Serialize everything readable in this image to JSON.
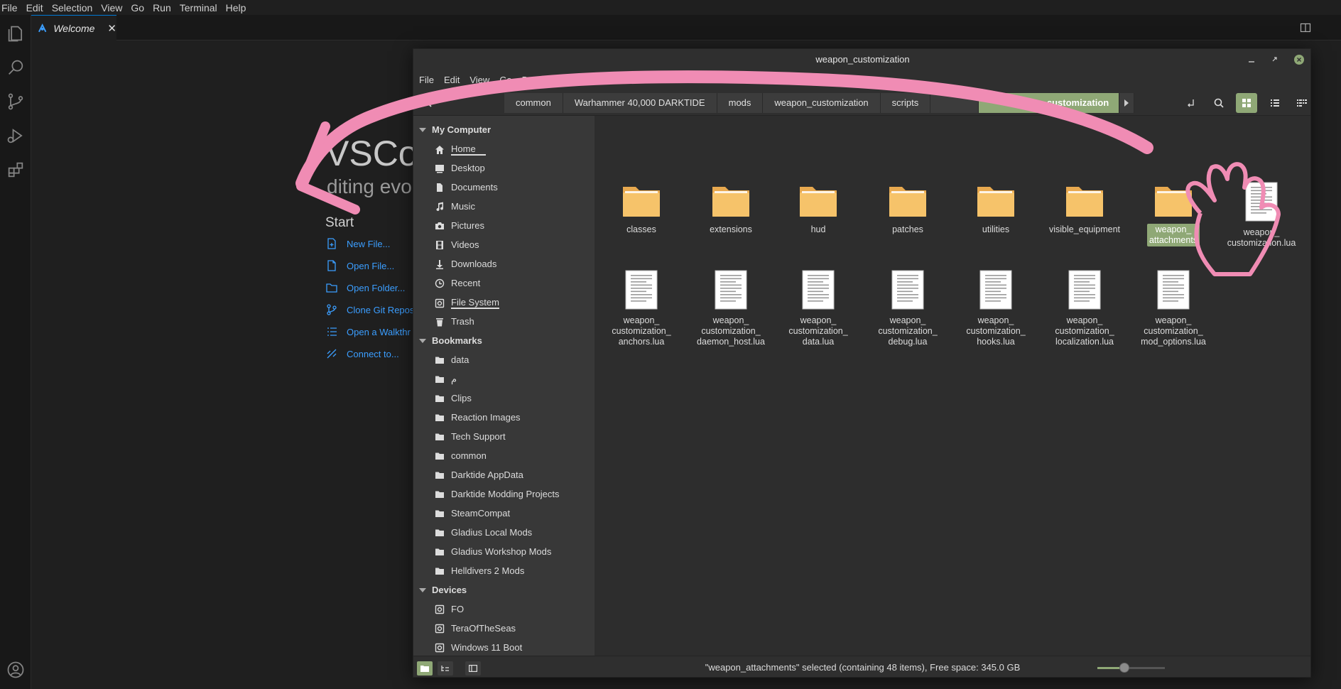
{
  "vscode": {
    "menu": [
      "File",
      "Edit",
      "Selection",
      "View",
      "Go",
      "Run",
      "Terminal",
      "Help"
    ],
    "tab_label": "Welcome",
    "title_fragment": "VSCodiu",
    "subtitle_fragment": "diting evo",
    "start_heading": "Start",
    "start_links": [
      "New File...",
      "Open File...",
      "Open Folder...",
      "Clone Git Repos",
      "Open a Walkthr",
      "Connect to..."
    ]
  },
  "nemo": {
    "title": "weapon_customization",
    "menu": [
      "File",
      "Edit",
      "View",
      "Go",
      "Book"
    ],
    "path": [
      "common",
      "Warhammer 40,000 DARKTIDE",
      "mods",
      "weapon_customization",
      "scripts",
      "",
      "weapon_customization"
    ],
    "sidebar": {
      "my_computer": {
        "heading": "My Computer",
        "items": [
          {
            "label": "Home",
            "icon": "home-icon"
          },
          {
            "label": "Desktop",
            "icon": "desktop-icon"
          },
          {
            "label": "Documents",
            "icon": "document-icon"
          },
          {
            "label": "Music",
            "icon": "music-icon"
          },
          {
            "label": "Pictures",
            "icon": "camera-icon"
          },
          {
            "label": "Videos",
            "icon": "film-icon"
          },
          {
            "label": "Downloads",
            "icon": "download-icon"
          },
          {
            "label": "Recent",
            "icon": "clock-icon"
          },
          {
            "label": "File System",
            "icon": "drive-icon"
          },
          {
            "label": "Trash",
            "icon": "trash-icon"
          }
        ]
      },
      "bookmarks": {
        "heading": "Bookmarks",
        "items": [
          "data",
          "م",
          "Clips",
          "Reaction Images",
          "Tech Support",
          "common",
          "Darktide AppData",
          "Darktide Modding Projects",
          "SteamCompat",
          "Gladius Local Mods",
          "Gladius Workshop Mods",
          "Helldivers 2 Mods"
        ]
      },
      "devices": {
        "heading": "Devices",
        "items": [
          "FO",
          "TeraOfTheSeas",
          "Windows 11 Boot"
        ]
      }
    },
    "files_row1": [
      {
        "lines": [
          "classes"
        ],
        "type": "folder"
      },
      {
        "lines": [
          "extensions"
        ],
        "type": "folder"
      },
      {
        "lines": [
          "hud"
        ],
        "type": "folder"
      },
      {
        "lines": [
          "patches"
        ],
        "type": "folder"
      },
      {
        "lines": [
          "utilities"
        ],
        "type": "folder"
      },
      {
        "lines": [
          "visible_equipment"
        ],
        "type": "folder"
      },
      {
        "lines": [
          "weapon_",
          "attachments"
        ],
        "type": "folder",
        "selected": true
      },
      {
        "lines": [
          "weapon_",
          "customization.lua"
        ],
        "type": "file"
      }
    ],
    "files_row2": [
      {
        "lines": [
          "weapon_",
          "customization_",
          "anchors.lua"
        ],
        "type": "file"
      },
      {
        "lines": [
          "weapon_",
          "customization_",
          "daemon_host.lua"
        ],
        "type": "file"
      },
      {
        "lines": [
          "weapon_",
          "customization_",
          "data.lua"
        ],
        "type": "file"
      },
      {
        "lines": [
          "weapon_",
          "customization_",
          "debug.lua"
        ],
        "type": "file"
      },
      {
        "lines": [
          "weapon_",
          "customization_",
          "hooks.lua"
        ],
        "type": "file"
      },
      {
        "lines": [
          "weapon_",
          "customization_",
          "localization.lua"
        ],
        "type": "file"
      },
      {
        "lines": [
          "weapon_",
          "customization_",
          "mod_options.lua"
        ],
        "type": "file"
      }
    ],
    "status": "\"weapon_attachments\" selected (containing 48 items), Free space: 345.0 GB",
    "zoom_fraction": 0.4,
    "accent": "#8fa876",
    "folder_color": "#f6c36a"
  },
  "annotation": {
    "color": "#f08cb4"
  }
}
